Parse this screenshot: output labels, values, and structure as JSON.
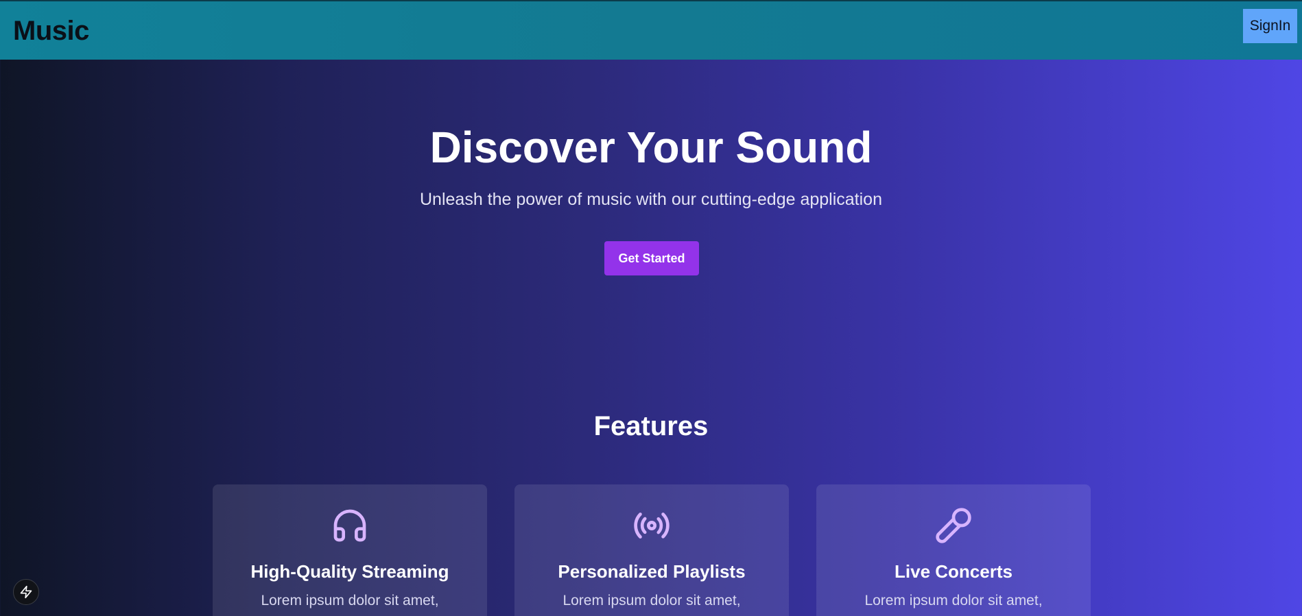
{
  "navbar": {
    "brand": "Music",
    "signin_label": "SignIn"
  },
  "hero": {
    "title": "Discover Your Sound",
    "subtitle": "Unleash the power of music with our cutting-edge application",
    "cta_label": "Get Started"
  },
  "features": {
    "title": "Features",
    "items": [
      {
        "icon": "headphones-icon",
        "title": "High-Quality Streaming",
        "desc": "Lorem ipsum dolor sit amet,"
      },
      {
        "icon": "radio-broadcast-icon",
        "title": "Personalized Playlists",
        "desc": "Lorem ipsum dolor sit amet,"
      },
      {
        "icon": "microphone-icon",
        "title": "Live Concerts",
        "desc": "Lorem ipsum dolor sit amet,"
      }
    ]
  },
  "colors": {
    "navbar": "#137a92",
    "signin_bg": "#60a5fa",
    "cta_bg": "#9333ea",
    "icon": "#d8b4fe",
    "gradient_start": "#0f1526",
    "gradient_end": "#4f46e5"
  },
  "floating_button": {
    "icon": "lightning-bolt-icon"
  }
}
